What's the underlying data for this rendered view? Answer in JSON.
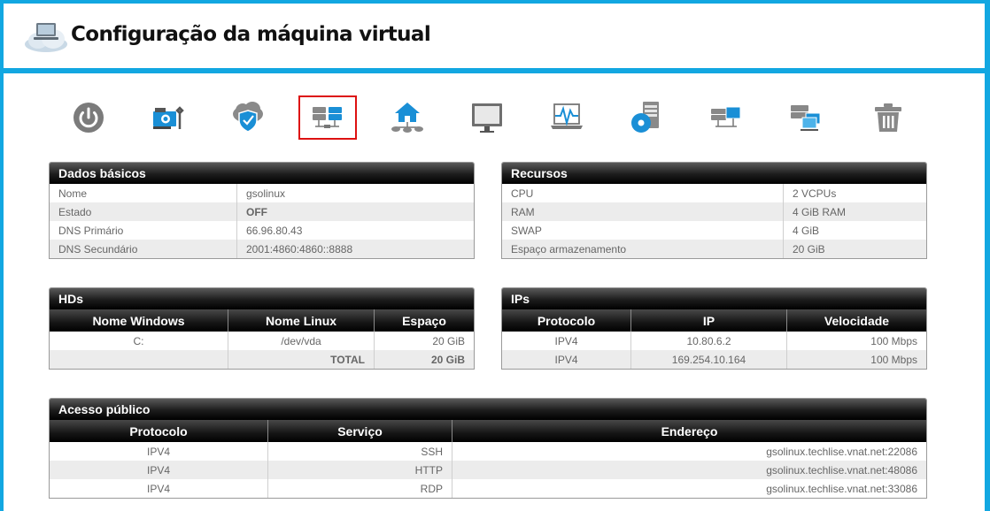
{
  "header": {
    "title": "Configuração da máquina virtual"
  },
  "toolbar": {
    "icons": [
      "power-icon",
      "network-card-icon",
      "cloud-shield-icon",
      "storage-drives-icon",
      "home-network-icon",
      "monitor-icon",
      "network-monitor-icon",
      "disk-install-icon",
      "network-transfer-icon",
      "server-screens-icon",
      "trash-icon"
    ],
    "active_index": 3
  },
  "basic": {
    "title": "Dados básicos",
    "rows": [
      {
        "label": "Nome",
        "value": "gsolinux"
      },
      {
        "label": "Estado",
        "value": "OFF"
      },
      {
        "label": "DNS Primário",
        "value": "66.96.80.43"
      },
      {
        "label": "DNS Secundário",
        "value": "2001:4860:4860::8888"
      }
    ]
  },
  "resources": {
    "title": "Recursos",
    "rows": [
      {
        "label": "CPU",
        "value": "2 VCPUs"
      },
      {
        "label": "RAM",
        "value": "4 GiB RAM"
      },
      {
        "label": "SWAP",
        "value": "4 GiB"
      },
      {
        "label": "Espaço armazenamento",
        "value": "20 GiB"
      }
    ]
  },
  "hds": {
    "title": "HDs",
    "headers": [
      "Nome Windows",
      "Nome Linux",
      "Espaço"
    ],
    "rows": [
      [
        "C:",
        "/dev/vda",
        "20 GiB"
      ]
    ],
    "total": {
      "label": "TOTAL",
      "value": "20 GiB"
    }
  },
  "ips": {
    "title": "IPs",
    "headers": [
      "Protocolo",
      "IP",
      "Velocidade"
    ],
    "rows": [
      [
        "IPV4",
        "10.80.6.2",
        "100 Mbps"
      ],
      [
        "IPV4",
        "169.254.10.164",
        "100 Mbps"
      ]
    ]
  },
  "public": {
    "title": "Acesso público",
    "headers": [
      "Protocolo",
      "Serviço",
      "Endereço"
    ],
    "rows": [
      [
        "IPV4",
        "SSH",
        "gsolinux.techlise.vnat.net:22086"
      ],
      [
        "IPV4",
        "HTTP",
        "gsolinux.techlise.vnat.net:48086"
      ],
      [
        "IPV4",
        "RDP",
        "gsolinux.techlise.vnat.net:33086"
      ]
    ]
  },
  "colors": {
    "frame": "#12a7e1",
    "active_border": "#dd1111",
    "icon_blue": "#1a8fd6",
    "icon_gray": "#777777"
  }
}
